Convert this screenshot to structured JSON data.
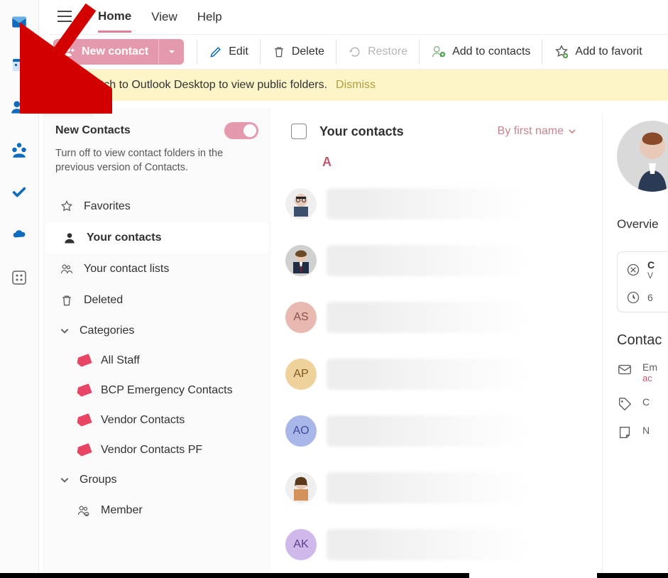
{
  "rail": {
    "tooltip": "People"
  },
  "menu": {
    "tabs": [
      "Home",
      "View",
      "Help"
    ],
    "active": 0
  },
  "toolbar": {
    "new_label": "New contact",
    "edit": "Edit",
    "delete": "Delete",
    "restore": "Restore",
    "add_contacts": "Add to contacts",
    "add_favorite": "Add to favorit"
  },
  "banner": {
    "text": "Switch to Outlook Desktop to view public folders.",
    "dismiss": "Dismiss"
  },
  "sidebar": {
    "panel_title": "New Contacts",
    "panel_desc": "Turn off to view contact folders in the previous version of Contacts.",
    "items": {
      "favorites": "Favorites",
      "your_contacts": "Your contacts",
      "contact_lists": "Your contact lists",
      "deleted": "Deleted",
      "categories": "Categories",
      "groups": "Groups"
    },
    "categories": [
      "All Staff",
      "BCP Emergency Contacts",
      "Vendor Contacts",
      "Vendor Contacts PF"
    ],
    "groups": [
      "Member"
    ]
  },
  "contacts": {
    "title": "Your contacts",
    "sort_label": "By first name",
    "letter": "A",
    "rows": [
      {
        "type": "photo",
        "variant": 1
      },
      {
        "type": "photo",
        "variant": 2
      },
      {
        "type": "initials",
        "text": "AS",
        "bg": "#e8b9b0",
        "fg": "#8b5248"
      },
      {
        "type": "initials",
        "text": "AP",
        "bg": "#efd19b",
        "fg": "#7a5c1f"
      },
      {
        "type": "initials",
        "text": "AO",
        "bg": "#a9b7e8",
        "fg": "#3b4d9a"
      },
      {
        "type": "photo",
        "variant": 3
      },
      {
        "type": "initials",
        "text": "AK",
        "bg": "#cfb9ea",
        "fg": "#5a3f8a"
      }
    ]
  },
  "detail": {
    "tab": "Overvie",
    "card_lines": [
      "C",
      "V",
      "6"
    ],
    "section": "Contac",
    "email_label": "Em",
    "email_sub": "ac",
    "cat_label": "C",
    "note_label": "N"
  }
}
